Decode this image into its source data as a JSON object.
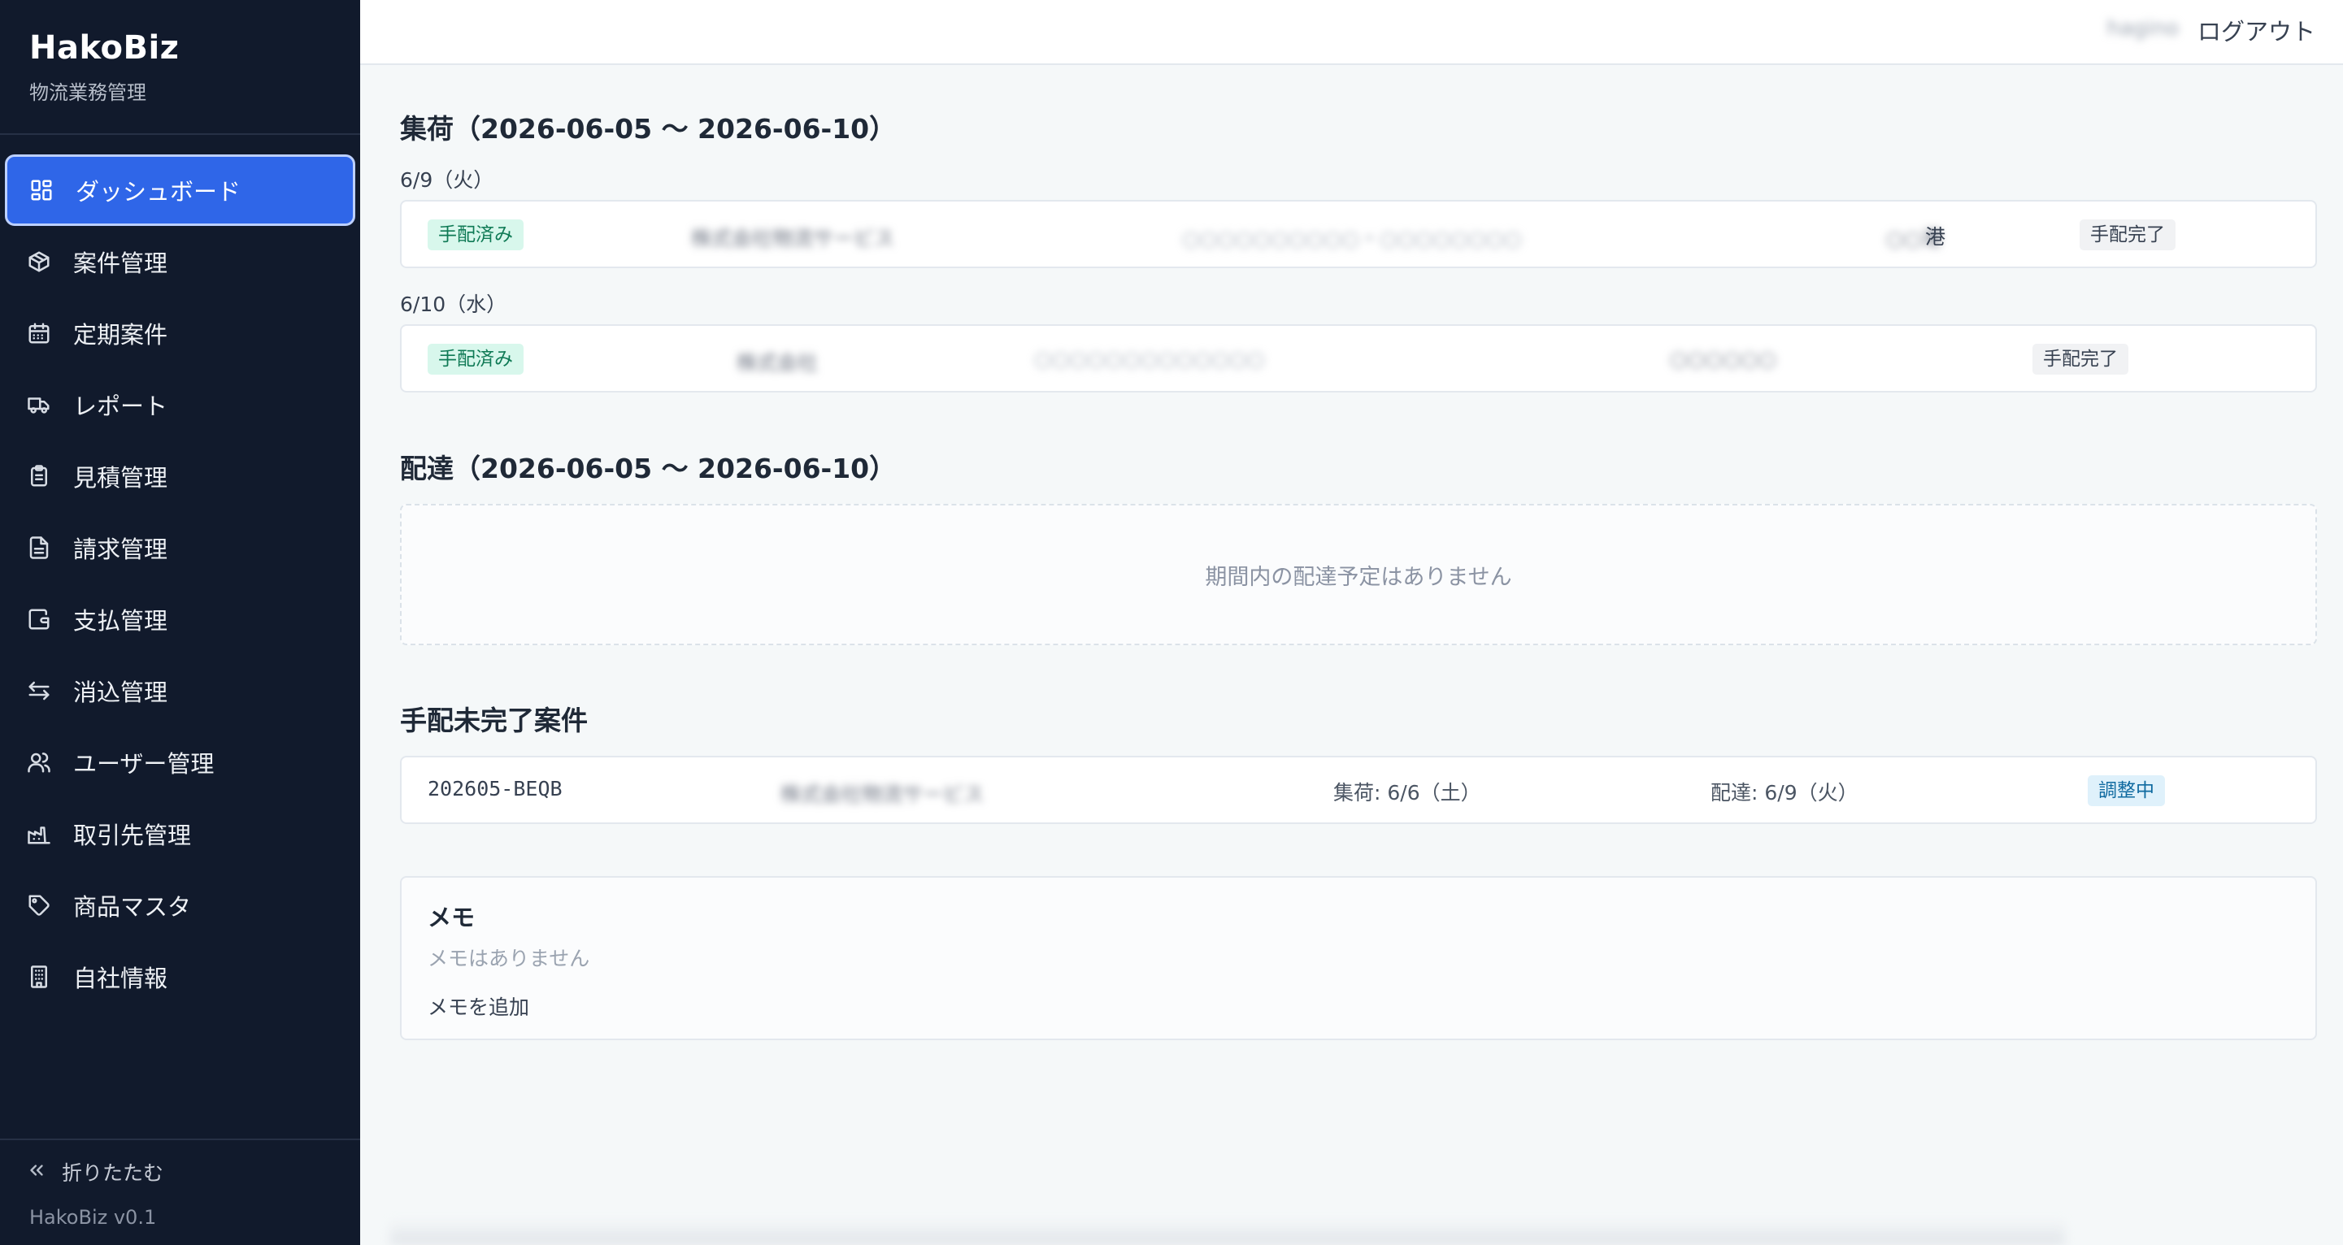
{
  "app": {
    "name": "HakoBiz",
    "subtitle": "物流業務管理",
    "version": "HakoBiz v0.1"
  },
  "sidebar": {
    "items": [
      {
        "label": "ダッシュボード",
        "icon": "dashboard-icon",
        "active": true
      },
      {
        "label": "案件管理",
        "icon": "package-icon"
      },
      {
        "label": "定期案件",
        "icon": "calendar-icon"
      },
      {
        "label": "レポート",
        "icon": "truck-icon"
      },
      {
        "label": "見積管理",
        "icon": "clipboard-icon"
      },
      {
        "label": "請求管理",
        "icon": "document-icon"
      },
      {
        "label": "支払管理",
        "icon": "wallet-icon"
      },
      {
        "label": "消込管理",
        "icon": "swap-arrows-icon"
      },
      {
        "label": "ユーザー管理",
        "icon": "users-icon"
      },
      {
        "label": "取引先管理",
        "icon": "factory-icon"
      },
      {
        "label": "商品マスタ",
        "icon": "tag-icon"
      },
      {
        "label": "自社情報",
        "icon": "building-icon"
      }
    ],
    "collapse_label": "折りたたむ"
  },
  "topbar": {
    "username": "hagino",
    "logout_label": "ログアウト"
  },
  "pickup": {
    "title": "集荷（2026-06-05 〜 2026-06-10）",
    "days": [
      {
        "label": "6/9（火）",
        "rows": [
          {
            "status": "手配済み",
            "customer": "株式会社物流サービス",
            "address": "○○○○○○○○○○・○○○○○○○○",
            "port": "○○港",
            "port_suffix": "港",
            "arrangement": "手配完了"
          }
        ]
      },
      {
        "label": "6/10（水）",
        "rows": [
          {
            "status": "手配済み",
            "customer": "株式会社",
            "address": "○○○○○○○○○○○○○",
            "port": "○○○○○○",
            "arrangement": "手配完了"
          }
        ]
      }
    ]
  },
  "delivery": {
    "title": "配達（2026-06-05 〜 2026-06-10）",
    "empty": "期間内の配達予定はありません"
  },
  "pending": {
    "title": "手配未完了案件",
    "rows": [
      {
        "id": "202605-BEQB",
        "customer": "株式会社物流サービス",
        "pickup": "集荷: 6/6（土）",
        "delivery": "配達: 6/9（火）",
        "status": "調整中"
      }
    ]
  },
  "memo": {
    "title": "メモ",
    "empty": "メモはありません",
    "add_label": "メモを追加"
  },
  "colors": {
    "sidebar_bg": "#111a2c",
    "active_bg": "#2f66e8",
    "badge_green_bg": "#d8f7ec",
    "badge_blue_bg": "#dff1fb"
  }
}
